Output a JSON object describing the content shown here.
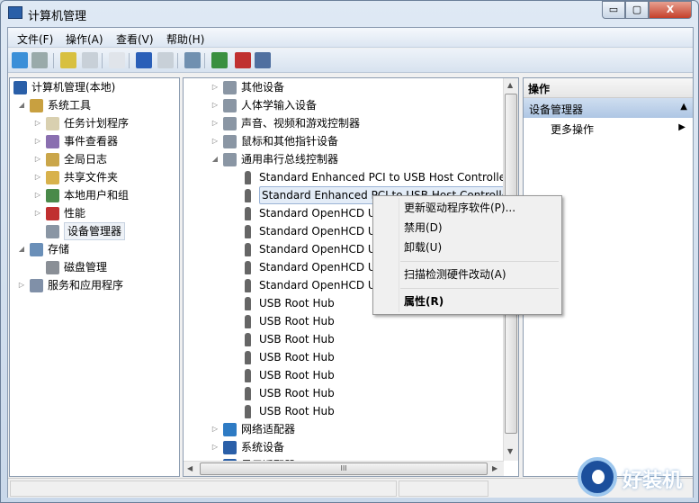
{
  "window": {
    "title": "计算机管理",
    "min": "▭",
    "max": "▢",
    "close": "X"
  },
  "menu": [
    "文件(F)",
    "操作(A)",
    "查看(V)",
    "帮助(H)"
  ],
  "toolbar": [
    "back-arrow-icon",
    "forward-arrow-icon",
    "up-folder-icon",
    "show-hide-tree-icon",
    "properties-icon",
    "help-icon",
    "show-hide-action-pane-icon",
    "scan-hardware-icon",
    "update-driver-icon",
    "uninstall-device-icon",
    "disable-device-icon"
  ],
  "left_tree": [
    {
      "label": "计算机管理(本地)",
      "level": 0,
      "exp": "",
      "icon": "computer-management-icon"
    },
    {
      "label": "系统工具",
      "level": 1,
      "exp": "◢",
      "icon": "system-tools-icon"
    },
    {
      "label": "任务计划程序",
      "level": 2,
      "exp": "▷",
      "icon": "clock-icon"
    },
    {
      "label": "事件查看器",
      "level": 2,
      "exp": "▷",
      "icon": "event-viewer-icon"
    },
    {
      "label": "全局日志",
      "level": 2,
      "exp": "▷",
      "icon": "log-icon"
    },
    {
      "label": "共享文件夹",
      "level": 2,
      "exp": "▷",
      "icon": "shared-folder-icon"
    },
    {
      "label": "本地用户和组",
      "level": 2,
      "exp": "▷",
      "icon": "users-icon"
    },
    {
      "label": "性能",
      "level": 2,
      "exp": "▷",
      "icon": "performance-icon"
    },
    {
      "label": "设备管理器",
      "level": 2,
      "exp": "",
      "icon": "device-manager-icon",
      "selected": true
    },
    {
      "label": "存储",
      "level": 1,
      "exp": "◢",
      "icon": "storage-icon"
    },
    {
      "label": "磁盘管理",
      "level": 2,
      "exp": "",
      "icon": "disk-icon"
    },
    {
      "label": "服务和应用程序",
      "level": 1,
      "exp": "▷",
      "icon": "services-icon"
    }
  ],
  "device_tree": [
    {
      "label": "其他设备",
      "level": 0,
      "exp": "▷",
      "icon": "unknown-device-icon"
    },
    {
      "label": "人体学输入设备",
      "level": 0,
      "exp": "▷",
      "icon": "hid-icon"
    },
    {
      "label": "声音、视频和游戏控制器",
      "level": 0,
      "exp": "▷",
      "icon": "speaker-icon"
    },
    {
      "label": "鼠标和其他指针设备",
      "level": 0,
      "exp": "▷",
      "icon": "mouse-icon"
    },
    {
      "label": "通用串行总线控制器",
      "level": 0,
      "exp": "◢",
      "icon": "usb-icon"
    },
    {
      "label": "Standard Enhanced PCI to USB Host Controller",
      "level": 1,
      "exp": "",
      "icon": "usb-plug-icon"
    },
    {
      "label": "Standard Enhanced PCI to USB Host Controller",
      "level": 1,
      "exp": "",
      "icon": "usb-plug-icon",
      "highlight": true
    },
    {
      "label": "Standard OpenHCD USB Host Controller",
      "level": 1,
      "exp": "",
      "icon": "usb-plug-icon"
    },
    {
      "label": "Standard OpenHCD USB Host Controller",
      "level": 1,
      "exp": "",
      "icon": "usb-plug-icon"
    },
    {
      "label": "Standard OpenHCD USB Host Controller",
      "level": 1,
      "exp": "",
      "icon": "usb-plug-icon"
    },
    {
      "label": "Standard OpenHCD USB Host Controller",
      "level": 1,
      "exp": "",
      "icon": "usb-plug-icon"
    },
    {
      "label": "Standard OpenHCD USB Host Controller",
      "level": 1,
      "exp": "",
      "icon": "usb-plug-icon"
    },
    {
      "label": "USB Root Hub",
      "level": 1,
      "exp": "",
      "icon": "usb-plug-icon"
    },
    {
      "label": "USB Root Hub",
      "level": 1,
      "exp": "",
      "icon": "usb-plug-icon"
    },
    {
      "label": "USB Root Hub",
      "level": 1,
      "exp": "",
      "icon": "usb-plug-icon"
    },
    {
      "label": "USB Root Hub",
      "level": 1,
      "exp": "",
      "icon": "usb-plug-icon"
    },
    {
      "label": "USB Root Hub",
      "level": 1,
      "exp": "",
      "icon": "usb-plug-icon"
    },
    {
      "label": "USB Root Hub",
      "level": 1,
      "exp": "",
      "icon": "usb-plug-icon"
    },
    {
      "label": "USB Root Hub",
      "level": 1,
      "exp": "",
      "icon": "usb-plug-icon"
    },
    {
      "label": "网络适配器",
      "level": 0,
      "exp": "▷",
      "icon": "network-adapter-icon"
    },
    {
      "label": "系统设备",
      "level": 0,
      "exp": "▷",
      "icon": "system-devices-icon"
    },
    {
      "label": "显示适配器",
      "level": 0,
      "exp": "▷",
      "icon": "display-adapter-icon"
    }
  ],
  "actions": {
    "header": "操作",
    "section": "设备管理器",
    "section_arrow": "▲",
    "more": "更多操作",
    "more_arrow": "▶"
  },
  "context_menu": {
    "items": [
      "更新驱动程序软件(P)...",
      "禁用(D)",
      "卸载(U)",
      "扫描检测硬件改动(A)",
      "属性(R)"
    ]
  },
  "scroll": {
    "grip": "III",
    "up": "▲",
    "down": "▼",
    "left": "◀",
    "right": "▶"
  },
  "watermark": "好装机",
  "colors": {
    "accent": "#aec6e4",
    "titlebar": "#dfe9f4",
    "close": "#c4402a"
  }
}
